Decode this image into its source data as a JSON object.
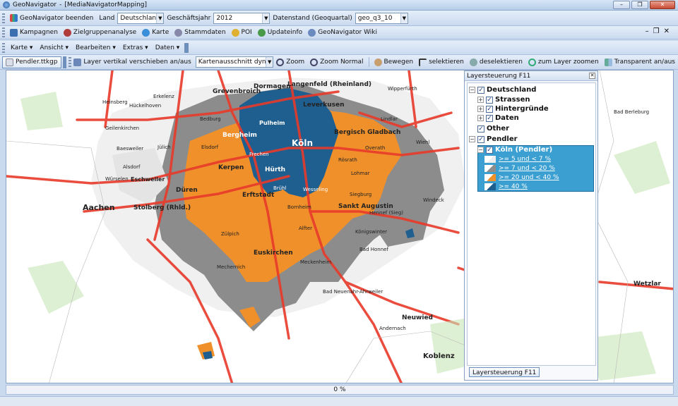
{
  "window": {
    "app_name": "GeoNavigator",
    "document": "[MediaNavigatorMapping]"
  },
  "toolbar1": {
    "quit_label": "GeoNavigator beenden",
    "land_label": "Land",
    "land_value": "Deutschland",
    "year_label": "Geschäftsjahr",
    "year_value": "2012",
    "datastand_label": "Datenstand (Geoquartal)",
    "datastand_value": "geo_q3_10"
  },
  "toolbar2": {
    "items": [
      "Kampagnen",
      "Zielgruppenanalyse",
      "Karte",
      "Stammdaten",
      "POI",
      "Updateinfo",
      "GeoNavigator Wiki"
    ]
  },
  "menu": {
    "items": [
      "Karte ▾",
      "Ansicht ▾",
      "Bearbeiten ▾",
      "Extras ▾",
      "Daten ▾"
    ]
  },
  "toolbar4": {
    "tab_label": "Pendler.ttkgp",
    "layer_move_label": "Layer vertikal verschieben an/aus",
    "kartenausschnitt_value": "Kartenausschnitt dynamisch",
    "zoom_label": "Zoom",
    "zoom_normal_label": "Zoom Normal",
    "move_label": "Bewegen",
    "select_label": "selektieren",
    "deselect_label": "deselektieren",
    "zoom_layer_label": "zum Layer zoomen",
    "transparent_label": "Transparent an/aus"
  },
  "map": {
    "cities": [
      {
        "name": "Grevenbroich",
        "bold": true
      },
      {
        "name": "Dormagen",
        "bold": true
      },
      {
        "name": "Langenfeld (Rheinland)",
        "bold": true
      },
      {
        "name": "Wipperfürth",
        "bold": false
      },
      {
        "name": "Leverkusen",
        "bold": true
      },
      {
        "name": "Heinsberg",
        "bold": false
      },
      {
        "name": "Hückelhoven",
        "bold": false
      },
      {
        "name": "Erkelenz",
        "bold": false
      },
      {
        "name": "Bedburg",
        "bold": false
      },
      {
        "name": "Pulheim",
        "bold": true
      },
      {
        "name": "Lindlar",
        "bold": false
      },
      {
        "name": "Geilenkirchen",
        "bold": false
      },
      {
        "name": "Bergheim",
        "bold": true
      },
      {
        "name": "Bergisch Gladbach",
        "bold": true
      },
      {
        "name": "Wiehl",
        "bold": false
      },
      {
        "name": "Bad Berleburg",
        "bold": false
      },
      {
        "name": "Baesweiler",
        "bold": false
      },
      {
        "name": "Jülich",
        "bold": false
      },
      {
        "name": "Elsdorf",
        "bold": false
      },
      {
        "name": "Köln",
        "bold": true
      },
      {
        "name": "Overath",
        "bold": false
      },
      {
        "name": "Frechen",
        "bold": false
      },
      {
        "name": "Rösrath",
        "bold": false
      },
      {
        "name": "Alsdorf",
        "bold": false
      },
      {
        "name": "Kerpen",
        "bold": true
      },
      {
        "name": "Hürth",
        "bold": true
      },
      {
        "name": "Lohmar",
        "bold": false
      },
      {
        "name": "Würselen",
        "bold": false
      },
      {
        "name": "Eschweiler",
        "bold": true
      },
      {
        "name": "Düren",
        "bold": true
      },
      {
        "name": "Brühl",
        "bold": false
      },
      {
        "name": "Wesseling",
        "bold": false
      },
      {
        "name": "Siegburg",
        "bold": false
      },
      {
        "name": "Erftstadt",
        "bold": true
      },
      {
        "name": "Windeck",
        "bold": false
      },
      {
        "name": "Aachen",
        "bold": true
      },
      {
        "name": "Stolberg (Rhld.)",
        "bold": true
      },
      {
        "name": "Bornheim",
        "bold": false
      },
      {
        "name": "Sankt Augustin",
        "bold": true
      },
      {
        "name": "Hennef (Sieg)",
        "bold": false
      },
      {
        "name": "Zülpich",
        "bold": false
      },
      {
        "name": "Alfter",
        "bold": false
      },
      {
        "name": "Königswinter",
        "bold": false
      },
      {
        "name": "Bad Honnef",
        "bold": false
      },
      {
        "name": "Euskirchen",
        "bold": true
      },
      {
        "name": "Meckenheim",
        "bold": false
      },
      {
        "name": "Mechernich",
        "bold": false
      },
      {
        "name": "Wetzlar",
        "bold": true
      },
      {
        "name": "Bad Neuenahr-Ahrweiler",
        "bold": false
      },
      {
        "name": "Neuwied",
        "bold": true
      },
      {
        "name": "Andernach",
        "bold": false
      },
      {
        "name": "Koblenz",
        "bold": true
      }
    ]
  },
  "layer_panel": {
    "title": "Layersteuerung F11",
    "tab_label": "Layersteuerung F11",
    "nodes": {
      "deutschland": "Deutschland",
      "strassen": "Strassen",
      "hintergruende": "Hintergründe",
      "daten": "Daten",
      "other": "Other",
      "pendler": "Pendler",
      "koeln": "Köln (Pendler)"
    },
    "legend": [
      {
        "label": ">= 5 und < 7 %",
        "color": "#eeeeee"
      },
      {
        "label": ">= 7 und < 20 %",
        "color": "#8c8c8c"
      },
      {
        "label": ">= 20 und < 40 %",
        "color": "#f0902a"
      },
      {
        "label": ">= 40 %",
        "color": "#1f5f8f"
      }
    ]
  },
  "status": {
    "progress": "0 %"
  }
}
